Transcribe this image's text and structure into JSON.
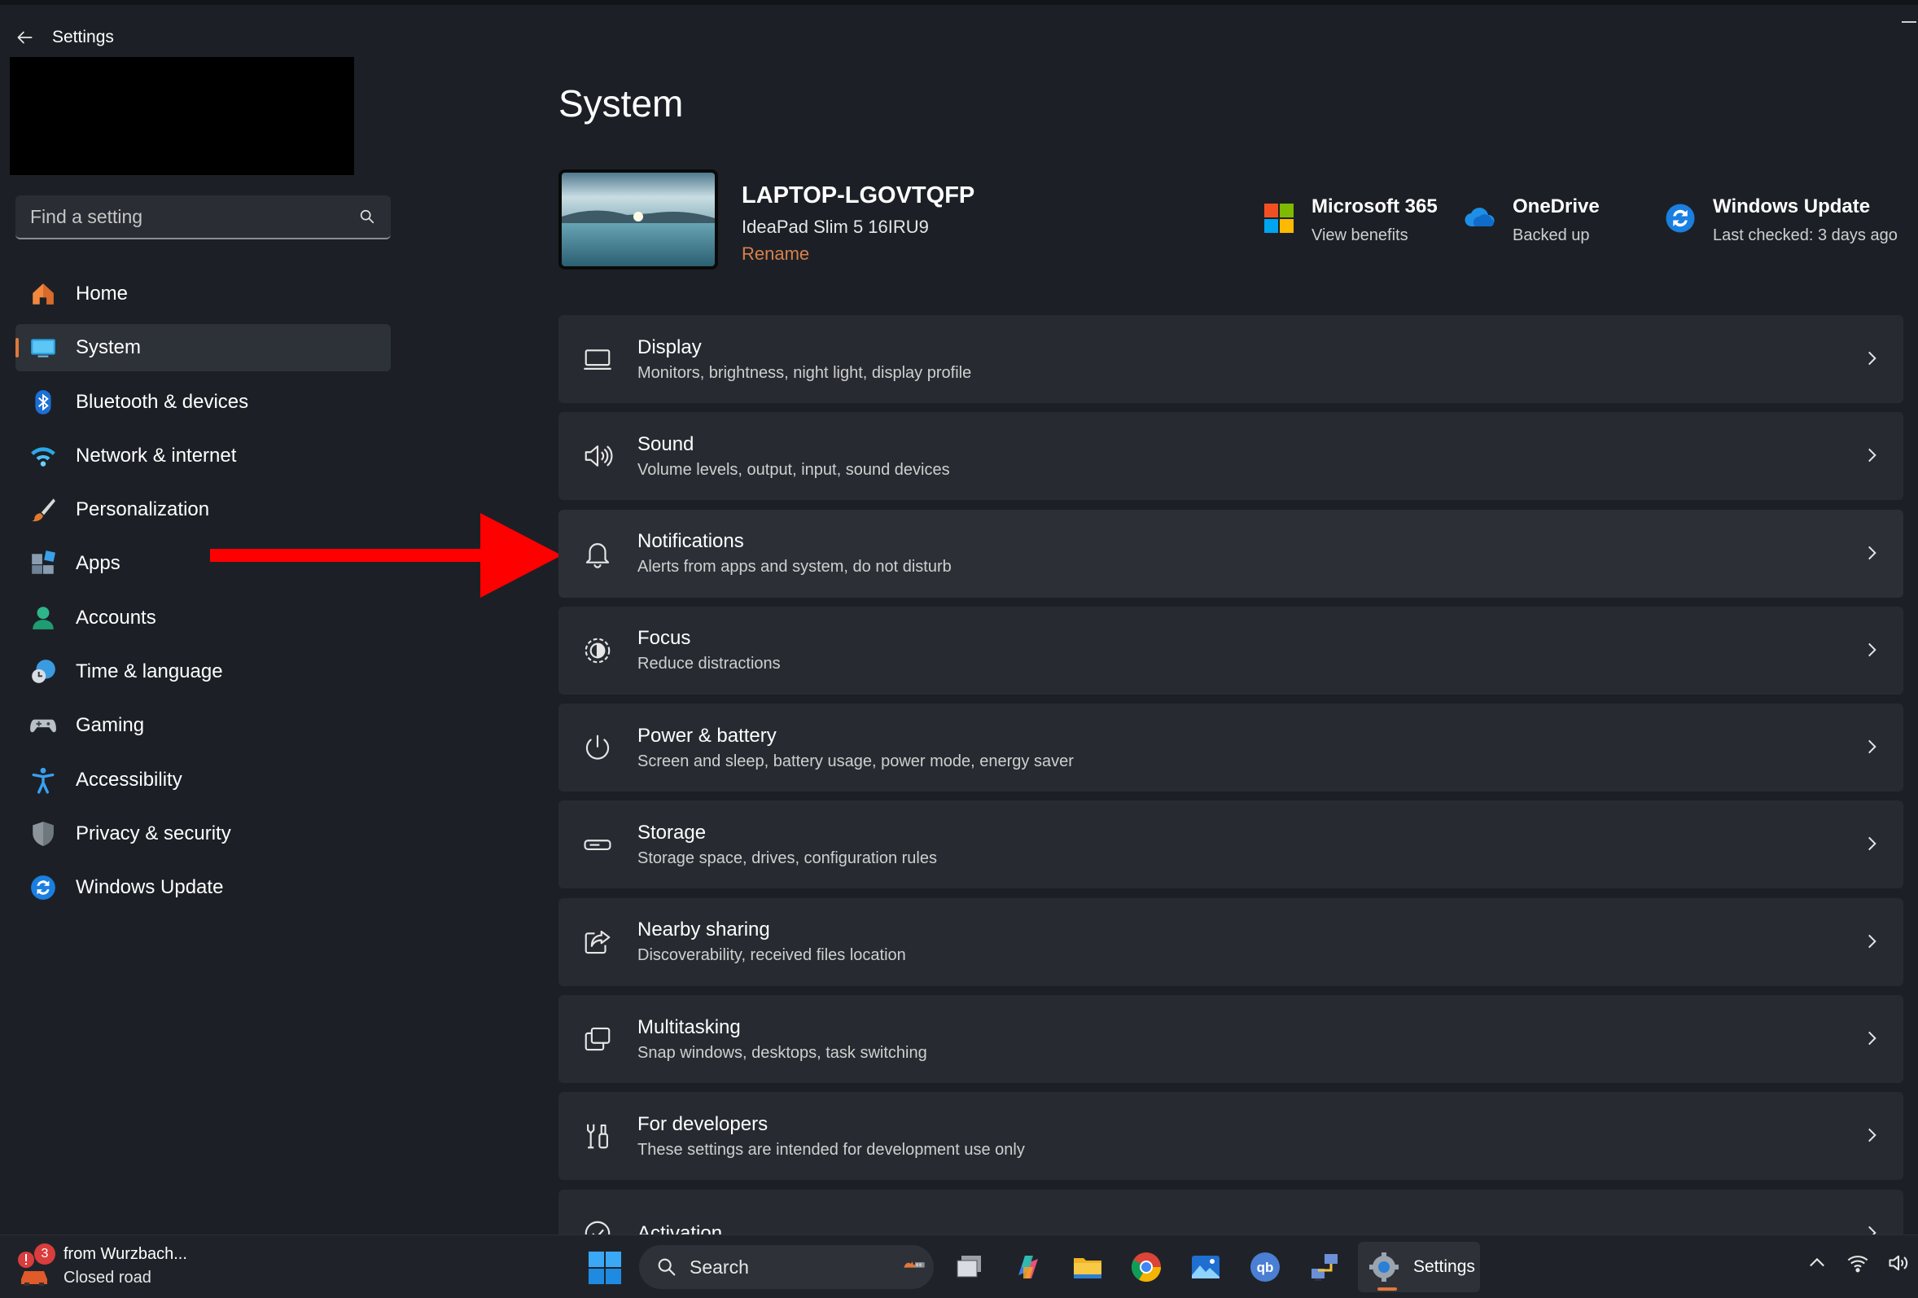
{
  "window": {
    "title": "Settings"
  },
  "search": {
    "placeholder": "Find a setting"
  },
  "sidebar": {
    "items": [
      {
        "label": "Home",
        "icon": "home-icon"
      },
      {
        "label": "System",
        "icon": "system-icon",
        "active": true
      },
      {
        "label": "Bluetooth & devices",
        "icon": "bluetooth-icon"
      },
      {
        "label": "Network & internet",
        "icon": "wifi-icon"
      },
      {
        "label": "Personalization",
        "icon": "brush-icon"
      },
      {
        "label": "Apps",
        "icon": "apps-icon"
      },
      {
        "label": "Accounts",
        "icon": "account-icon"
      },
      {
        "label": "Time & language",
        "icon": "clock-globe-icon"
      },
      {
        "label": "Gaming",
        "icon": "gamepad-icon"
      },
      {
        "label": "Accessibility",
        "icon": "accessibility-icon"
      },
      {
        "label": "Privacy & security",
        "icon": "shield-icon"
      },
      {
        "label": "Windows Update",
        "icon": "update-icon"
      }
    ]
  },
  "main": {
    "title": "System",
    "device": {
      "name": "LAPTOP-LGOVTQFP",
      "model": "IdeaPad Slim 5 16IRU9",
      "rename_label": "Rename"
    },
    "services": [
      {
        "title": "Microsoft 365",
        "subtitle": "View benefits",
        "icon": "microsoft-logo-icon"
      },
      {
        "title": "OneDrive",
        "subtitle": "Backed up",
        "icon": "onedrive-cloud-icon"
      },
      {
        "title": "Windows Update",
        "subtitle": "Last checked: 3 days ago",
        "icon": "update-icon"
      }
    ],
    "settings": [
      {
        "title": "Display",
        "description": "Monitors, brightness, night light, display profile",
        "icon": "display-icon"
      },
      {
        "title": "Sound",
        "description": "Volume levels, output, input, sound devices",
        "icon": "speaker-icon"
      },
      {
        "title": "Notifications",
        "description": "Alerts from apps and system, do not disturb",
        "icon": "bell-icon"
      },
      {
        "title": "Focus",
        "description": "Reduce distractions",
        "icon": "focus-icon"
      },
      {
        "title": "Power & battery",
        "description": "Screen and sleep, battery usage, power mode, energy saver",
        "icon": "power-icon"
      },
      {
        "title": "Storage",
        "description": "Storage space, drives, configuration rules",
        "icon": "storage-icon"
      },
      {
        "title": "Nearby sharing",
        "description": "Discoverability, received files location",
        "icon": "share-icon"
      },
      {
        "title": "Multitasking",
        "description": "Snap windows, desktops, task switching",
        "icon": "multitasking-icon"
      },
      {
        "title": "For developers",
        "description": "These settings are intended for development use only",
        "icon": "developer-tools-icon"
      },
      {
        "title": "Activation",
        "description": "",
        "icon": "activation-check-icon"
      }
    ]
  },
  "taskbar": {
    "weather": {
      "badge": "3",
      "line1": "from Wurzbach...",
      "line2": "Closed road"
    },
    "search_label": "Search",
    "active_app_label": "Settings",
    "apps": [
      "task-view-icon",
      "copilot-icon",
      "file-explorer-icon",
      "chrome-icon",
      "photos-icon",
      "qbittorrent-icon",
      "network-tool-icon"
    ]
  },
  "colors": {
    "accent": "#e0783a",
    "background": "#1c2026",
    "card": "#272b31",
    "annotation_arrow": "#ff0000"
  }
}
